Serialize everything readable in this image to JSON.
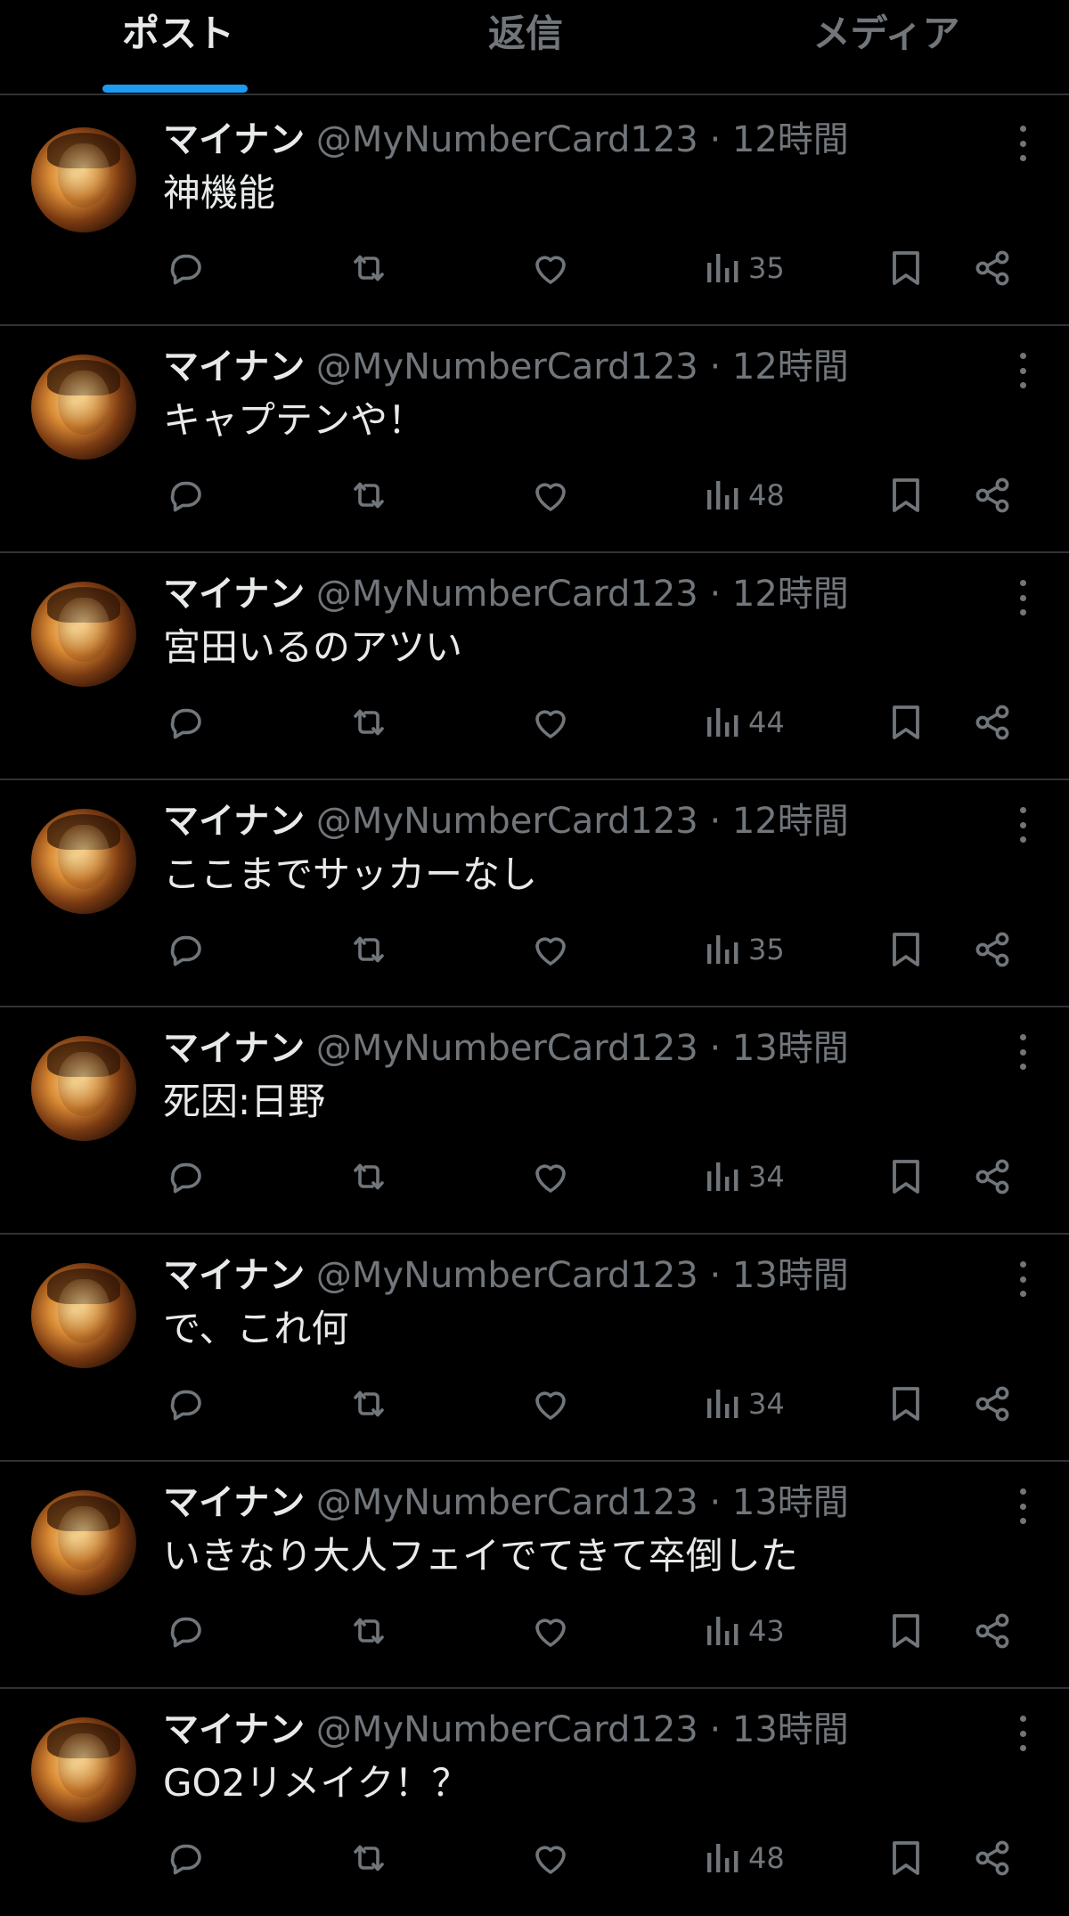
{
  "tabs": [
    {
      "label": "ポスト",
      "active": true
    },
    {
      "label": "返信",
      "active": false
    },
    {
      "label": "メディア",
      "active": false
    }
  ],
  "accent_color": "#1d9bf0",
  "icons": {
    "reply": "reply-icon",
    "repost": "repost-icon",
    "like": "heart-icon",
    "views": "views-chart-icon",
    "bookmark": "bookmark-icon",
    "share": "share-icon",
    "more": "more-vertical-icon"
  },
  "posts": [
    {
      "name": "マイナン",
      "handle": "@MyNumberCard123",
      "dot": "·",
      "time": "12時間",
      "text": "神機能",
      "views": "35"
    },
    {
      "name": "マイナン",
      "handle": "@MyNumberCard123",
      "dot": "·",
      "time": "12時間",
      "text": "キャプテンや！",
      "views": "48"
    },
    {
      "name": "マイナン",
      "handle": "@MyNumberCard123",
      "dot": "·",
      "time": "12時間",
      "text": "宮田いるのアツい",
      "views": "44"
    },
    {
      "name": "マイナン",
      "handle": "@MyNumberCard123",
      "dot": "·",
      "time": "12時間",
      "text": "ここまでサッカーなし",
      "views": "35"
    },
    {
      "name": "マイナン",
      "handle": "@MyNumberCard123",
      "dot": "·",
      "time": "13時間",
      "text": "死因:日野",
      "views": "34"
    },
    {
      "name": "マイナン",
      "handle": "@MyNumberCard123",
      "dot": "·",
      "time": "13時間",
      "text": "で、これ何",
      "views": "34"
    },
    {
      "name": "マイナン",
      "handle": "@MyNumberCard123",
      "dot": "·",
      "time": "13時間",
      "text": "いきなり大人フェイでてきて卒倒した",
      "views": "43"
    },
    {
      "name": "マイナン",
      "handle": "@MyNumberCard123",
      "dot": "·",
      "time": "13時間",
      "text": "GO2リメイク！？",
      "views": "48"
    }
  ]
}
